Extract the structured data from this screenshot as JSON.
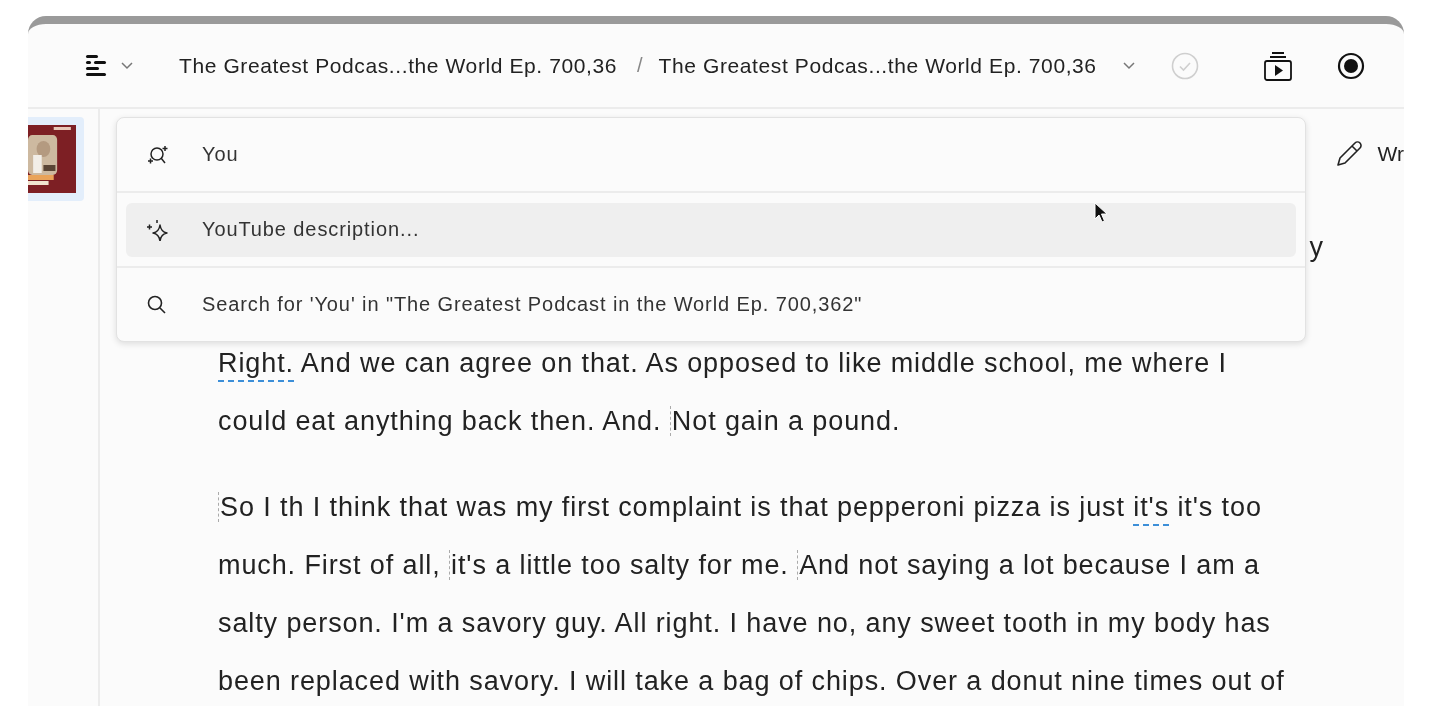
{
  "toolbar": {
    "breadcrumbs": [
      "The Greatest Podcas...the World Ep. 700,36",
      "The Greatest Podcas...the World Ep. 700,36"
    ],
    "separator": "/",
    "saved": false
  },
  "write_button": {
    "label": "Wr"
  },
  "suggestions": [
    {
      "kind": "speaker",
      "label": "You",
      "selected": false
    },
    {
      "kind": "ai",
      "label": "YouTube description...",
      "selected": true
    },
    {
      "kind": "search",
      "label": "Search for 'You' in \"The Greatest Podcast in the World Ep. 700,362\"",
      "selected": false
    }
  ],
  "transcript": [
    {
      "covered_line_end": "y",
      "lines": [
        [
          {
            "text": "Right.",
            "flagged": true
          },
          {
            "text": " And we can agree on that. As opposed to like middle school, me where I"
          }
        ],
        [
          {
            "text": "could eat anything back then. And. "
          },
          {
            "text": "Not gain a pound.",
            "marker": true
          }
        ]
      ]
    },
    {
      "lines": [
        [
          {
            "text": "So I th I think that was my first complaint is that pepperoni pizza is just ",
            "marker": true
          },
          {
            "text": "it's",
            "flagged": true
          },
          {
            "text": " it's too"
          }
        ],
        [
          {
            "text": "much. First of all, "
          },
          {
            "text": "it's a little too salty for me. ",
            "marker": true
          },
          {
            "text": "And not saying a lot because I am a",
            "marker": true
          }
        ],
        [
          {
            "text": "salty person. I'm a savory guy. All right. I have no, any sweet tooth in my body has"
          }
        ],
        [
          {
            "text": "been replaced with savory. I will take a bag of chips. Over a donut nine times out of"
          }
        ]
      ]
    }
  ]
}
